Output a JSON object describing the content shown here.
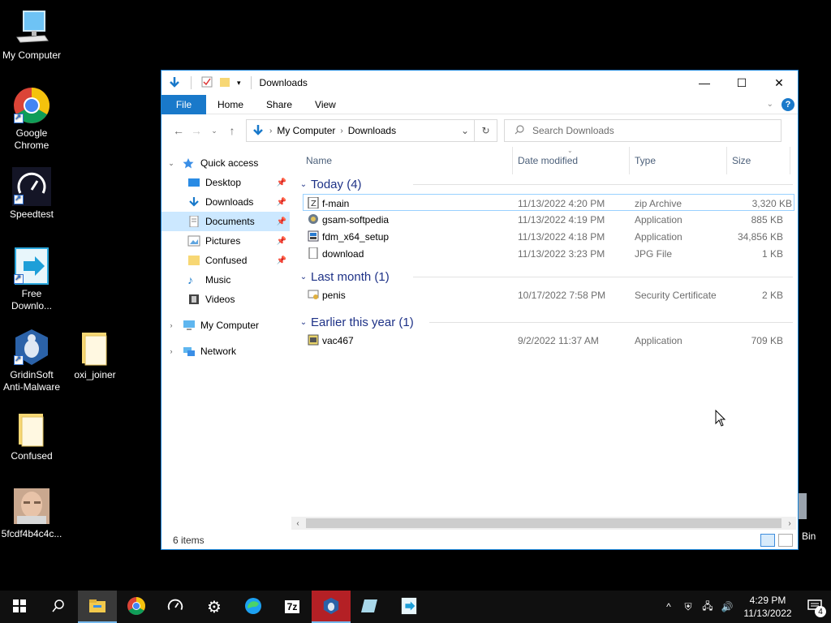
{
  "desktop": {
    "icons": [
      {
        "label": "My Computer"
      },
      {
        "label": "Google Chrome"
      },
      {
        "label": "Speedtest"
      },
      {
        "label": "Free Downlo..."
      },
      {
        "label": "GridinSoft Anti-Malware"
      },
      {
        "label": "oxi_joiner"
      },
      {
        "label": "Confused"
      },
      {
        "label": "5fcdf4b4c4c..."
      },
      {
        "label": "Bin"
      }
    ]
  },
  "window": {
    "title": "Downloads",
    "controls": {
      "minimize": "—",
      "maximize": "☐",
      "close": "✕"
    },
    "ribbon": {
      "file": "File",
      "tabs": [
        "Home",
        "Share",
        "View"
      ],
      "help": "?"
    },
    "address": {
      "crumbs": [
        "My Computer",
        "Downloads"
      ]
    },
    "search": {
      "placeholder": "Search Downloads"
    },
    "nav": {
      "quick_access": "Quick access",
      "items": [
        "Desktop",
        "Downloads",
        "Documents",
        "Pictures",
        "Confused",
        "Music",
        "Videos"
      ],
      "my_computer": "My Computer",
      "network": "Network"
    },
    "columns": {
      "name": "Name",
      "date": "Date modified",
      "type": "Type",
      "size": "Size"
    },
    "groups": [
      {
        "label": "Today (4)",
        "files": [
          {
            "name": "f-main",
            "date": "11/13/2022 4:20 PM",
            "type": "zip Archive",
            "size": "3,320 KB",
            "icon": "zip-icon"
          },
          {
            "name": "gsam-softpedia",
            "date": "11/13/2022 4:19 PM",
            "type": "Application",
            "size": "885 KB",
            "icon": "installer-icon"
          },
          {
            "name": "fdm_x64_setup",
            "date": "11/13/2022 4:18 PM",
            "type": "Application",
            "size": "34,856 KB",
            "icon": "setup-icon"
          },
          {
            "name": "download",
            "date": "11/13/2022 3:23 PM",
            "type": "JPG File",
            "size": "1 KB",
            "icon": "image-file-icon"
          }
        ]
      },
      {
        "label": "Last month (1)",
        "files": [
          {
            "name": "penis",
            "date": "10/17/2022 7:58 PM",
            "type": "Security Certificate",
            "size": "2 KB",
            "icon": "certificate-icon"
          }
        ]
      },
      {
        "label": "Earlier this year (1)",
        "files": [
          {
            "name": "vac467",
            "date": "9/2/2022 11:37 AM",
            "type": "Application",
            "size": "709 KB",
            "icon": "app-icon"
          }
        ]
      }
    ],
    "status": {
      "items": "6 items"
    }
  },
  "taskbar": {
    "clock_time": "4:29 PM",
    "clock_date": "11/13/2022",
    "notification_count": "4"
  },
  "colors": {
    "accent": "#1979ca",
    "selection": "#cce8ff",
    "group_header": "#1e3287",
    "taskbar": "#101010"
  }
}
